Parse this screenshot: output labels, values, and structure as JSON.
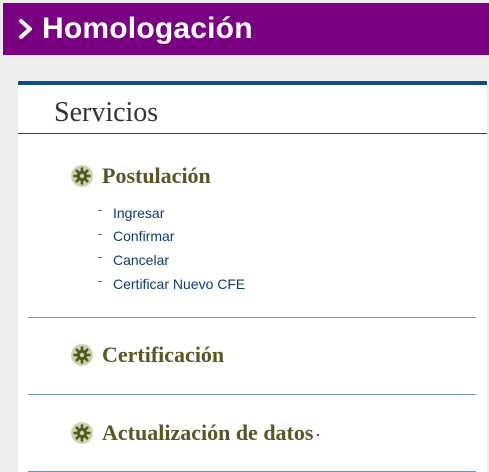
{
  "header": {
    "title": "Homologación",
    "icon": "chevron-right-icon",
    "background": "#7a0082"
  },
  "card": {
    "title": "Servicios",
    "accent": "#0f4c87"
  },
  "sections": [
    {
      "label": "Postulación",
      "icon": "gear-icon",
      "items": [
        {
          "label": "Ingresar"
        },
        {
          "label": "Confirmar"
        },
        {
          "label": "Cancelar"
        },
        {
          "label": "Certificar Nuevo CFE"
        }
      ]
    },
    {
      "label": "Certificación",
      "icon": "gear-icon"
    },
    {
      "label": "Actualización de datos",
      "icon": "gear-icon"
    }
  ]
}
